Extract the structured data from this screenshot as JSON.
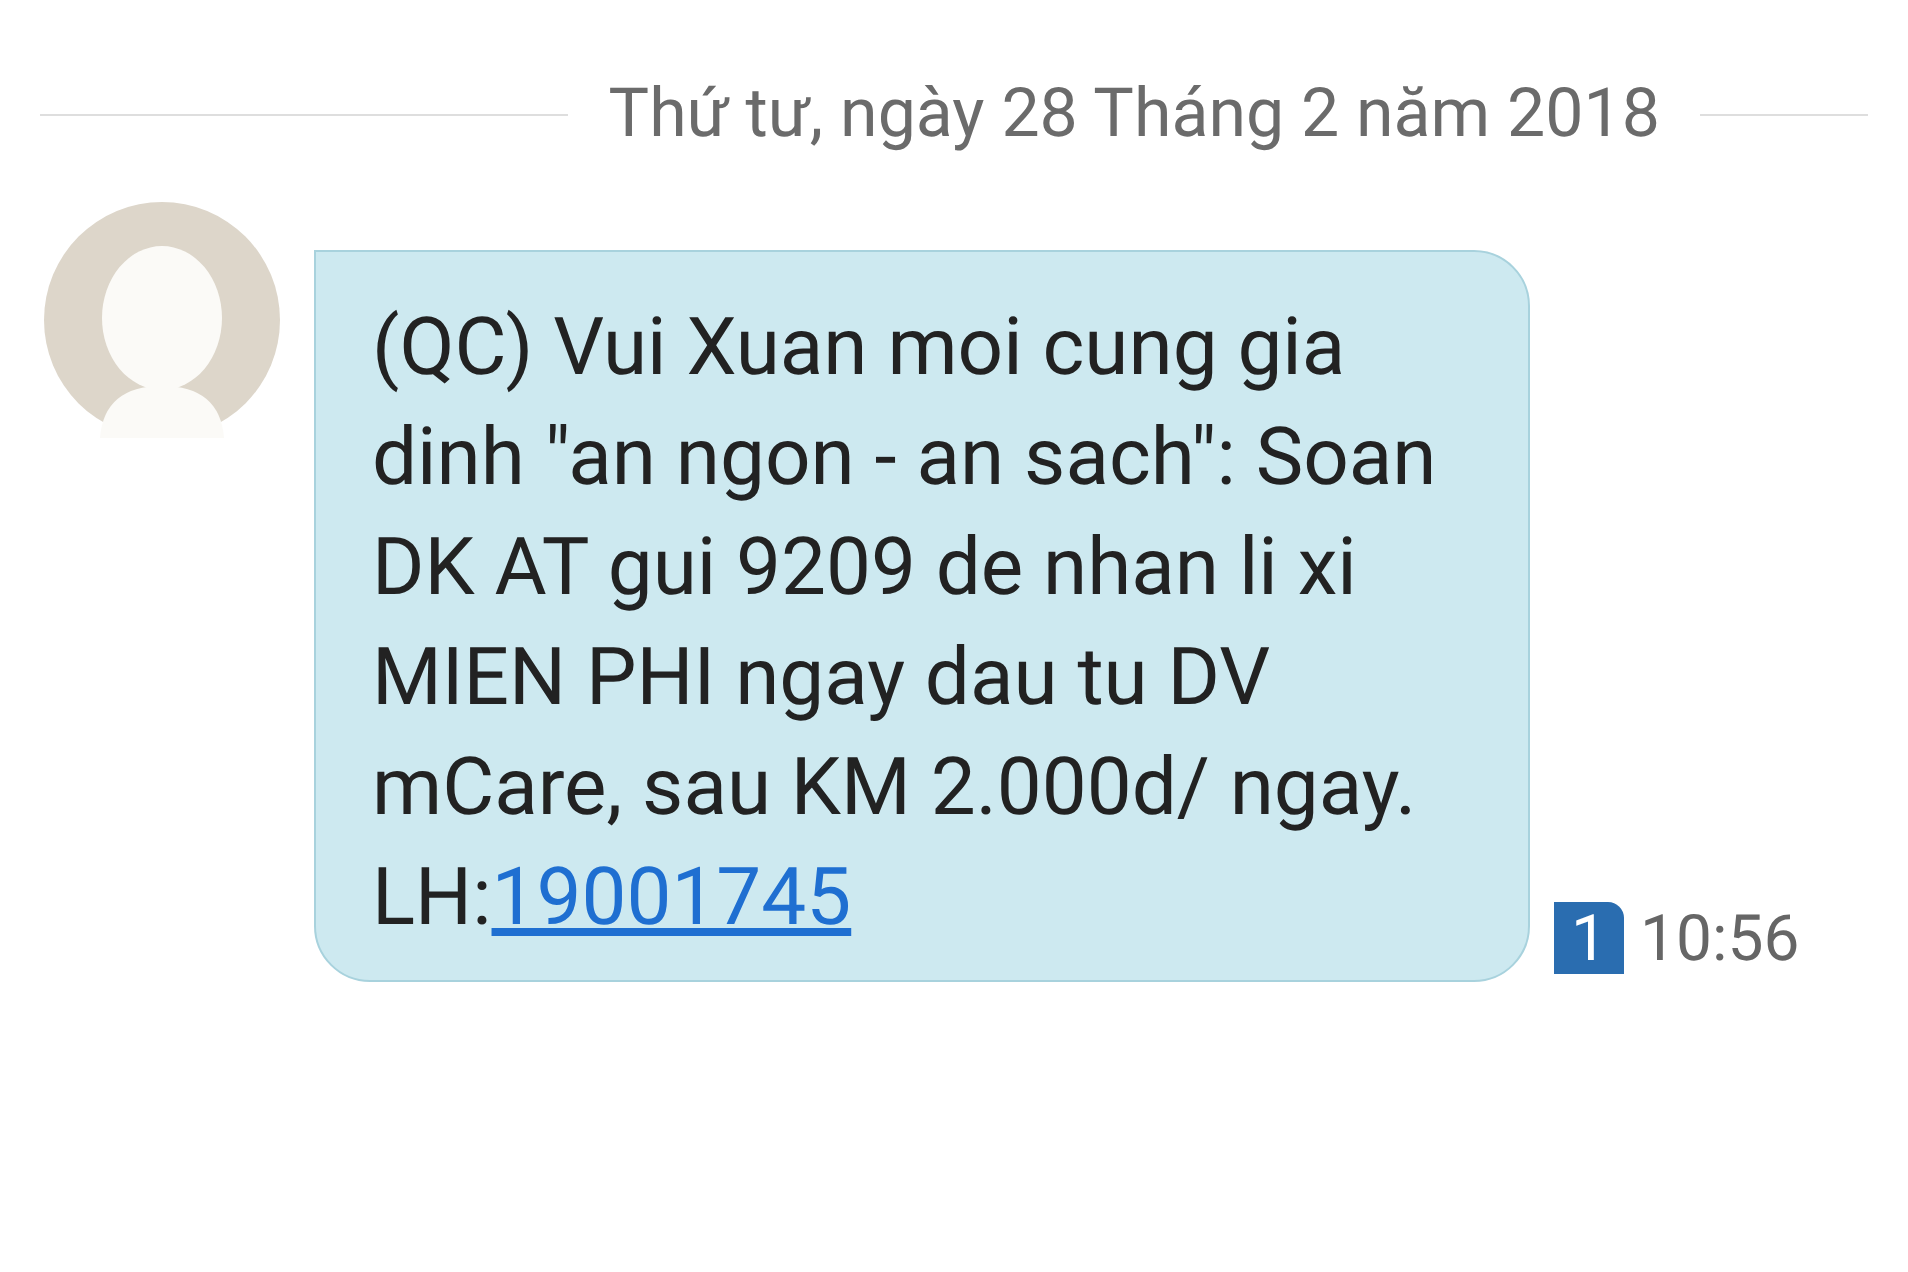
{
  "date_divider": "Thứ tư, ngày 28 Tháng 2 năm 2018",
  "messages": [
    {
      "text": "(QC) Vui Xuan moi cung gia dinh \"an ngon - an sach\": Soan DK AT gui 9209 de nhan li xi MIEN PHI ngay dau tu DV mCare, sau KM 2.000d/ ngay. LH:",
      "link": "19001745",
      "sim": "1",
      "time": "10:56"
    }
  ]
}
